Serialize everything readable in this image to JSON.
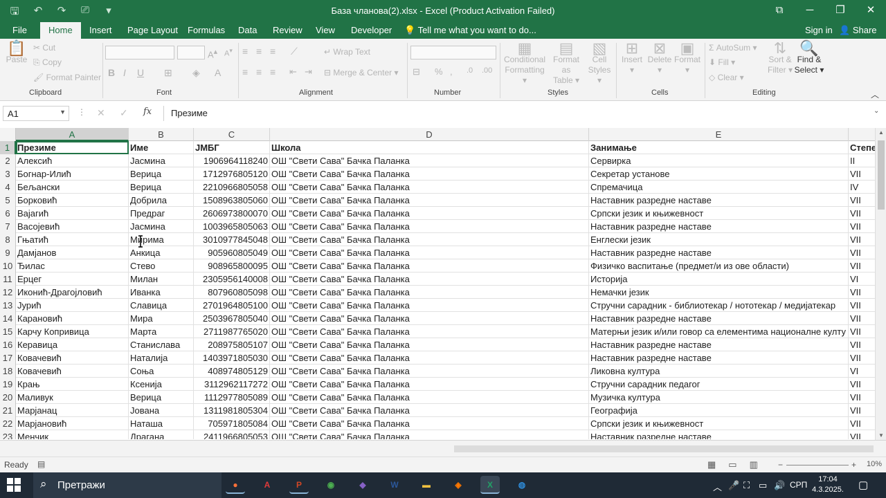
{
  "window": {
    "title": "База чланова(2).xlsx - Excel (Product Activation Failed)",
    "quick_access": [
      {
        "name": "save-icon",
        "glyph": "🖫"
      },
      {
        "name": "undo-icon",
        "glyph": "↶"
      },
      {
        "name": "redo-icon",
        "glyph": "↷"
      },
      {
        "name": "touch-mode-icon",
        "glyph": "⎚"
      },
      {
        "name": "customize-qat-icon",
        "glyph": "▾"
      }
    ],
    "controls": {
      "ribbon_display": "⧉",
      "minimize": "─",
      "maximize": "❐",
      "close": "✕"
    }
  },
  "tabs": [
    {
      "label": "File"
    },
    {
      "label": "Home"
    },
    {
      "label": "Insert"
    },
    {
      "label": "Page Layout"
    },
    {
      "label": "Formulas"
    },
    {
      "label": "Data"
    },
    {
      "label": "Review"
    },
    {
      "label": "View"
    },
    {
      "label": "Developer"
    }
  ],
  "tell_me": "Tell me what you want to do...",
  "sign_in": "Sign in",
  "share": "Share",
  "ribbon": {
    "clipboard": {
      "label": "Clipboard",
      "paste": "Paste",
      "cut": "Cut",
      "copy": "Copy",
      "format_painter": "Format Painter"
    },
    "font": {
      "label": "Font",
      "bold": "B",
      "italic": "I",
      "underline": "U"
    },
    "alignment": {
      "label": "Alignment",
      "wrap_text": "Wrap Text",
      "merge_center": "Merge & Center"
    },
    "number": {
      "label": "Number",
      "percent": "%"
    },
    "styles": {
      "label": "Styles",
      "conditional_1": "Conditional",
      "conditional_2": "Formatting",
      "format_table_1": "Format as",
      "format_table_2": "Table",
      "cell_styles_1": "Cell",
      "cell_styles_2": "Styles"
    },
    "cells": {
      "label": "Cells",
      "insert": "Insert",
      "delete": "Delete",
      "format": "Format"
    },
    "editing": {
      "label": "Editing",
      "autosum": "AutoSum",
      "fill": "Fill",
      "clear": "Clear",
      "sort_1": "Sort &",
      "sort_2": "Filter",
      "find_1": "Find &",
      "find_2": "Select"
    }
  },
  "formula_bar": {
    "name_box": "A1",
    "fx": "fx",
    "cancel": "✕",
    "enter": "✓",
    "content": "Презиме"
  },
  "columns": [
    {
      "letter": "A",
      "selected": true
    },
    {
      "letter": "B",
      "selected": false
    },
    {
      "letter": "C",
      "selected": false
    },
    {
      "letter": "D",
      "selected": false
    },
    {
      "letter": "E",
      "selected": false
    },
    {
      "letter": "",
      "selected": false
    }
  ],
  "rows": [
    {
      "n": "1",
      "cells": [
        "Презиме",
        "Име",
        "ЈМБГ",
        "Школа",
        "Занимање",
        "Степе"
      ],
      "header": true
    },
    {
      "n": "2",
      "cells": [
        "Алексић",
        "Јасмина",
        "1906964118240",
        "ОШ \"Свети Сава\" Бачка Паланка",
        "Сервирка",
        "II"
      ]
    },
    {
      "n": "3",
      "cells": [
        "Богнар-Илић",
        "Верица",
        "1712976805120",
        "ОШ \"Свети Сава\" Бачка Паланка",
        "Секретар установе",
        "VII"
      ]
    },
    {
      "n": "4",
      "cells": [
        "Бељански",
        "Верица",
        "2210966805058",
        "ОШ \"Свети Сава\" Бачка Паланка",
        "Спремачица",
        "IV"
      ]
    },
    {
      "n": "5",
      "cells": [
        "Борковић",
        "Добрила",
        "1508963805060",
        "ОШ \"Свети Сава\" Бачка Паланка",
        "Наставник разредне наставе",
        "VII"
      ]
    },
    {
      "n": "6",
      "cells": [
        "Вајагић",
        "Предраг",
        "2606973800070",
        "ОШ \"Свети Сава\" Бачка Паланка",
        "Српски језик и књижевност",
        "VII"
      ]
    },
    {
      "n": "7",
      "cells": [
        "Васојевић",
        "Јасмина",
        "1003965805063",
        "ОШ \"Свети Сава\" Бачка Паланка",
        "Наставник разредне наставе",
        "VII"
      ]
    },
    {
      "n": "8",
      "cells": [
        "Гњатић",
        "Мирима",
        "3010977845048",
        "ОШ \"Свети Сава\" Бачка Паланка",
        "Енглески језик",
        "VII"
      ]
    },
    {
      "n": "9",
      "cells": [
        "Дамјанов",
        "Анкица",
        "905960805049",
        "ОШ \"Свети Сава\" Бачка Паланка",
        "Наставник разредне наставе",
        "VII"
      ]
    },
    {
      "n": "10",
      "cells": [
        "Ђилас",
        "Стево",
        "908965800095",
        "ОШ \"Свети Сава\" Бачка Паланка",
        "Физичко васпитање (предмет/и из ове области)",
        "VII"
      ]
    },
    {
      "n": "11",
      "cells": [
        "Ерцег",
        "Милан",
        "2305956140008",
        "ОШ \"Свети Сава\" Бачка Паланка",
        "Историја",
        "VI"
      ]
    },
    {
      "n": "12",
      "cells": [
        "Иконић-Драгојловић",
        "Иванка",
        "807960805098",
        "ОШ \"Свети Сава\" Бачка Паланка",
        "Немачки језик",
        "VII"
      ]
    },
    {
      "n": "13",
      "cells": [
        "Јурић",
        "Славица",
        "2701964805100",
        "ОШ \"Свети Сава\" Бачка Паланка",
        "Стручни сарадник - библиотекар / нототекар / медијатекар",
        "VII"
      ]
    },
    {
      "n": "14",
      "cells": [
        "Карановић",
        "Мира",
        "2503967805040",
        "ОШ \"Свети Сава\" Бачка Паланка",
        "Наставник разредне наставе",
        "VII"
      ]
    },
    {
      "n": "15",
      "cells": [
        "Карчу Копривица",
        "Марта",
        "2711987765020",
        "ОШ \"Свети Сава\" Бачка Паланка",
        "Матерњи језик и/или говор са елементима националне култу",
        "VII"
      ]
    },
    {
      "n": "16",
      "cells": [
        "Керавица",
        "Станислава",
        "208975805107",
        "ОШ \"Свети Сава\" Бачка Паланка",
        "Наставник разредне наставе",
        "VII"
      ]
    },
    {
      "n": "17",
      "cells": [
        "Ковачевић",
        "Наталија",
        "1403971805030",
        "ОШ \"Свети Сава\" Бачка Паланка",
        "Наставник разредне наставе",
        "VII"
      ]
    },
    {
      "n": "18",
      "cells": [
        "Ковачевић",
        "Соња",
        "408974805129",
        "ОШ \"Свети Сава\" Бачка Паланка",
        "Ликовна култура",
        "VI"
      ]
    },
    {
      "n": "19",
      "cells": [
        "Крањ",
        "Ксенија",
        "3112962117272",
        "ОШ \"Свети Сава\" Бачка Паланка",
        "Стручни сарадник педагог",
        "VII"
      ]
    },
    {
      "n": "20",
      "cells": [
        "Маливук",
        "Верица",
        "1112977805089",
        "ОШ \"Свети Сава\" Бачка Паланка",
        "Музичка култура",
        "VII"
      ]
    },
    {
      "n": "21",
      "cells": [
        "Марјанац",
        "Јована",
        "1311981805304",
        "ОШ \"Свети Сава\" Бачка Паланка",
        "Географија",
        "VII"
      ]
    },
    {
      "n": "22",
      "cells": [
        "Марјановић",
        "Наташа",
        "705971805084",
        "ОШ \"Свети Сава\" Бачка Паланка",
        "Српски језик и књижевност",
        "VII"
      ]
    },
    {
      "n": "23",
      "cells": [
        "Менчик",
        "Драгана",
        "2411966805053",
        "ОШ \"Свети Сава\" Бачка Паланка",
        "Наставник разредне наставе",
        "VII"
      ]
    }
  ],
  "status": {
    "ready": "Ready",
    "zoom_minus": "−",
    "zoom_plus": "+",
    "zoom_percent": "10%"
  },
  "taskbar": {
    "search_placeholder": "Претражи",
    "apps": [
      {
        "name": "firefox-icon",
        "glyph": "●",
        "color": "#ff7139",
        "running": true
      },
      {
        "name": "acrobat-icon",
        "glyph": "A",
        "color": "#e03a3a",
        "running": false
      },
      {
        "name": "powerpoint-icon",
        "glyph": "P",
        "color": "#d24726",
        "running": true
      },
      {
        "name": "chrome-icon",
        "glyph": "◉",
        "color": "#4caf50",
        "running": false
      },
      {
        "name": "visual-studio-icon",
        "glyph": "◆",
        "color": "#8661c5",
        "running": false
      },
      {
        "name": "word-icon",
        "glyph": "W",
        "color": "#2b579a",
        "running": false
      },
      {
        "name": "file-explorer-icon",
        "glyph": "▬",
        "color": "#f0c040",
        "running": false
      },
      {
        "name": "avast-icon",
        "glyph": "◈",
        "color": "#ff7800",
        "running": false
      },
      {
        "name": "excel-icon",
        "glyph": "X",
        "color": "#21a366",
        "running": true
      },
      {
        "name": "globe-app-icon",
        "glyph": "◍",
        "color": "#2e8bd8",
        "running": false
      }
    ],
    "language": "СРП",
    "time": "17:04",
    "date": "4.3.2025."
  },
  "colors": {
    "excel_green": "#217346",
    "taskbar": "#1f2a36"
  }
}
